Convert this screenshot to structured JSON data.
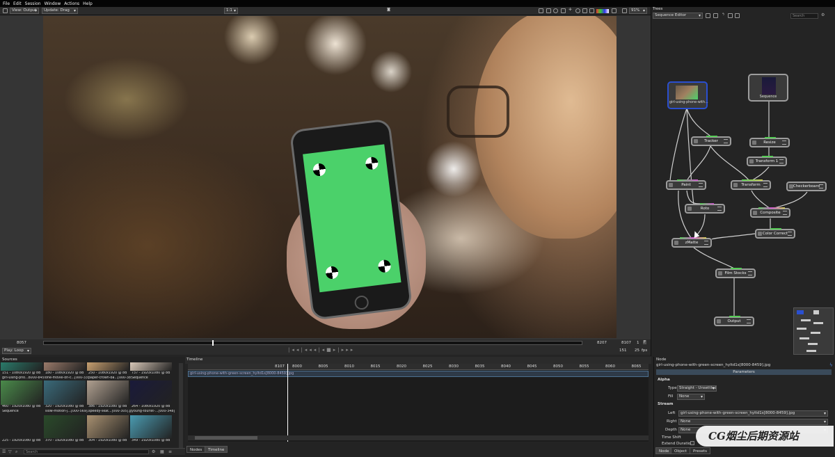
{
  "menu": [
    "File",
    "Edit",
    "Session",
    "Window",
    "Actions",
    "Help"
  ],
  "viewer": {
    "view_select": "View: Output",
    "update_select": "Update: Drag",
    "zoom_ratio": "1:1",
    "zoom_pct": "91%"
  },
  "transport": {
    "frame_start": "8057",
    "frame_end": "8207",
    "frame_current": "8107",
    "frame_step": "1",
    "frame_f": "F",
    "play_mode": "Play: Loop",
    "fps_value": "25",
    "fps_label": "fps",
    "range_value": "151"
  },
  "sources": {
    "title": "Sources",
    "search_placeholder": "Search",
    "items": [
      {
        "label": "151 - 1080x1920 @ 8B",
        "name": "girl-using-pho...8000-8459].jpg",
        "thumb": "#2a7a6a"
      },
      {
        "label": "180 - 1080x1920 @ 8B",
        "name": "one-movie-on-c...[000-335].jpg",
        "thumb": "#9a7a6a"
      },
      {
        "label": "250 - 1080x1920 @ 8B",
        "name": "paper-crown-ba...[000-385].tif",
        "thumb": "#c8a070"
      },
      {
        "label": "737 - 1920x1080 @ 8B",
        "name": "Sequence",
        "thumb": "#d8c8b8"
      },
      {
        "label": "460 - 1920x1080 @ 8B",
        "name": "Sequence",
        "thumb": "#4a8a4a"
      },
      {
        "label": "320 - 1920x1080 @ 8B",
        "name": "slow-motion-j...[000-569].jpg",
        "thumb": "#3a6a7a"
      },
      {
        "label": "386 - 1920x1080 @ 8B",
        "name": "speedy-skat...[000-305].jpg",
        "thumb": "#b0a090"
      },
      {
        "label": "264 - 1080x1920 @ 8B",
        "name": "young-tourist-...[000-348].jpg",
        "thumb": "#1a1a3a"
      },
      {
        "label": "225 - 1920x1080 @ 8B",
        "name": "",
        "thumb": "#222222"
      },
      {
        "label": "370 - 1920x1080 @ 8B",
        "name": "",
        "thumb": "#2a4a2a"
      },
      {
        "label": "304 - 1920x1080 @ 8B",
        "name": "",
        "thumb": "#a89070"
      },
      {
        "label": "349 - 1920x1080 @ 8B",
        "name": "",
        "thumb": "#4a9ab0"
      }
    ]
  },
  "timeline": {
    "title": "Timeline",
    "frame_marker": "8107",
    "ticks": [
      "8000",
      "8005",
      "8010",
      "8015",
      "8020",
      "8025",
      "8030",
      "8035",
      "8040",
      "8045",
      "8050",
      "8055",
      "8060",
      "8065"
    ],
    "clip": "girl-using-phone-with-green-screen_hyltd1s[8000-8459].jpg",
    "tabs": [
      "Nodes",
      "Timeline"
    ]
  },
  "trees": {
    "title": "Trees",
    "mode": "Sequence Editor",
    "search_placeholder": "Search",
    "nodes": [
      {
        "id": "n1",
        "label": "girl-using-phone-with..."
      },
      {
        "id": "n2",
        "label": "Sequence"
      },
      {
        "id": "n3",
        "label": "Tracker"
      },
      {
        "id": "n4",
        "label": "Resize"
      },
      {
        "id": "n5",
        "label": "Transform 1"
      },
      {
        "id": "n6",
        "label": "Paint"
      },
      {
        "id": "n7",
        "label": "Transform"
      },
      {
        "id": "n8",
        "label": "Checkerboard"
      },
      {
        "id": "n9",
        "label": "Roto"
      },
      {
        "id": "n10",
        "label": "Composite"
      },
      {
        "id": "n11",
        "label": "Color Correct"
      },
      {
        "id": "n12",
        "label": "zMatte"
      },
      {
        "id": "n13",
        "label": "Film Stocks"
      },
      {
        "id": "n14",
        "label": "Output"
      }
    ]
  },
  "node_panel": {
    "title": "Node",
    "node_name": "girl-using-phone-with-green-screen_hyltd1s[8000-8459].jpg",
    "params_header": "Parameters",
    "alpha": {
      "section": "Alpha",
      "type_label": "Type",
      "type_value": "Straight - Unsettled",
      "fill_label": "Fill",
      "fill_value": "None"
    },
    "stream": {
      "section": "Stream",
      "left_label": "Left",
      "left_value": "girl-using-phone-with-green-screen_hyltd1s[8000-8459].jpg",
      "right_label": "Right",
      "right_value": "None",
      "depth_label": "Depth",
      "depth_value": "None",
      "timeshift_label": "Time Shift",
      "extend_label": "Extend Duration"
    },
    "tabs": [
      "Node",
      "Object",
      "Presets"
    ]
  },
  "watermark": "CG烟尘后期资源站",
  "colors": {
    "accent": "#2a4fd0",
    "bg": "#242424",
    "green_screen": "#4bd16a"
  }
}
